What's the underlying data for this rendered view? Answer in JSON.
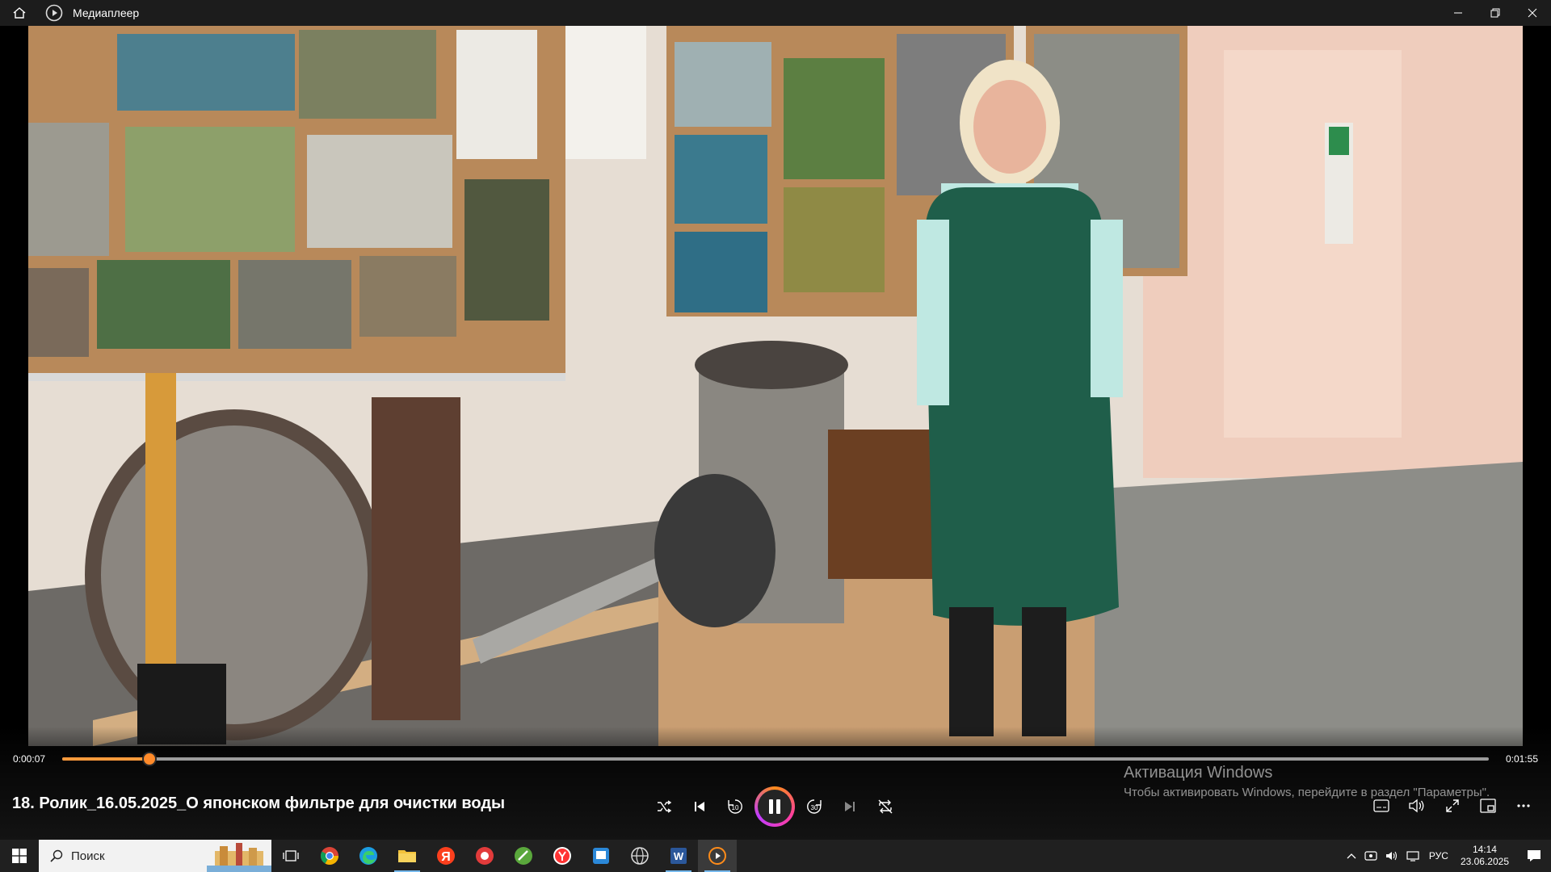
{
  "window": {
    "title": "Медиаплеер"
  },
  "player": {
    "current_time": "0:00:07",
    "total_time": "0:01:55",
    "progress": 0.0609,
    "media_title": "18. Ролик_16.05.2025_О японском фильтре для очистки воды"
  },
  "activation": {
    "title": "Активация Windows",
    "subtitle": "Чтобы активировать Windows, перейдите в раздел \"Параметры\"."
  },
  "taskbar": {
    "search_placeholder": "Поиск",
    "language": "РУС",
    "time": "14:14",
    "date": "23.06.2025"
  },
  "colors": {
    "accent": "#ff8a2a",
    "titlebar": "#1c1c1c",
    "taskbar": "#202020"
  }
}
